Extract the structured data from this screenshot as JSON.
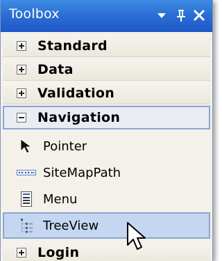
{
  "window": {
    "title": "Toolbox",
    "buttons": {
      "dropdown_icon": "dropdown-arrow-icon",
      "pin_icon": "pin-icon",
      "close_icon": "close-icon"
    }
  },
  "categories": [
    {
      "label": "Standard",
      "state": "collapsed"
    },
    {
      "label": "Data",
      "state": "collapsed"
    },
    {
      "label": "Validation",
      "state": "collapsed"
    },
    {
      "label": "Navigation",
      "state": "expanded",
      "selected": true
    }
  ],
  "navigation_items": [
    {
      "label": "Pointer",
      "icon": "pointer-icon"
    },
    {
      "label": "SiteMapPath",
      "icon": "sitemappath-icon"
    },
    {
      "label": "Menu",
      "icon": "menu-icon"
    },
    {
      "label": "TreeView",
      "icon": "treeview-icon",
      "highlighted": true
    }
  ],
  "trailing_category": {
    "label": "Login",
    "state": "collapsed"
  },
  "colors": {
    "titlebar": "#2b6fd6",
    "panel_bg": "#f3f1ea",
    "highlight_bg": "#c4d6f0",
    "highlight_border": "#8aa6cf"
  }
}
